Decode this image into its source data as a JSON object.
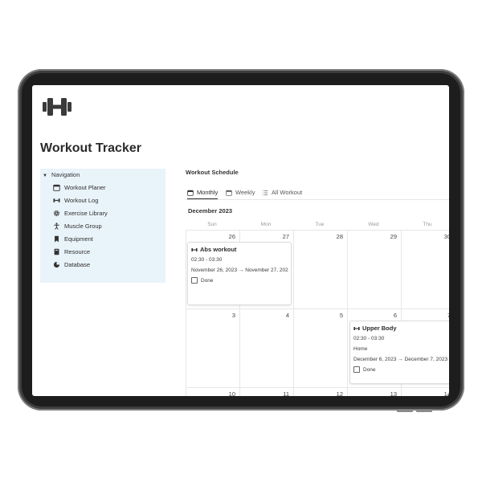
{
  "page": {
    "title": "Workout Tracker"
  },
  "navigation": {
    "heading": "Navigation",
    "items": [
      {
        "label": "Workout Planer",
        "icon": "calendar-icon"
      },
      {
        "label": "Workout Log",
        "icon": "dumbbell-icon"
      },
      {
        "label": "Exercise Library",
        "icon": "gear-icon"
      },
      {
        "label": "Muscle Group",
        "icon": "person-icon"
      },
      {
        "label": "Equipment",
        "icon": "bookmark-icon"
      },
      {
        "label": "Resource",
        "icon": "book-icon"
      },
      {
        "label": "Database",
        "icon": "pie-chart-icon"
      }
    ]
  },
  "schedule": {
    "title": "Workout Schedule",
    "tabs": [
      {
        "label": "Monthly",
        "icon": "calendar-icon",
        "active": true
      },
      {
        "label": "Weekly",
        "icon": "calendar-icon",
        "active": false
      },
      {
        "label": "All Workout",
        "icon": "list-icon",
        "active": false
      }
    ],
    "month": "December 2023",
    "weekdays": [
      "Sun",
      "Mon",
      "Tue",
      "Wed",
      "Thu"
    ],
    "weeks": [
      [
        "26",
        "27",
        "28",
        "29",
        "30"
      ],
      [
        "3",
        "4",
        "5",
        "6",
        "7"
      ],
      [
        "10",
        "11",
        "12",
        "13",
        "14"
      ]
    ],
    "events": [
      {
        "title": "Abs workout",
        "time": "02:30 - 03:30",
        "location": "",
        "dates": "November 26, 2023 → November 27, 202",
        "done_label": "Done"
      },
      {
        "title": "Upper Body",
        "time": "02:30 - 03:30",
        "location": "Home",
        "dates": "December 6, 2023 → December 7, 2023",
        "done_label": "Done"
      }
    ]
  },
  "colors": {
    "nav_bg": "#e9f3fa",
    "device_frame": "#3e3e3e",
    "text": "#2f2f2f"
  }
}
